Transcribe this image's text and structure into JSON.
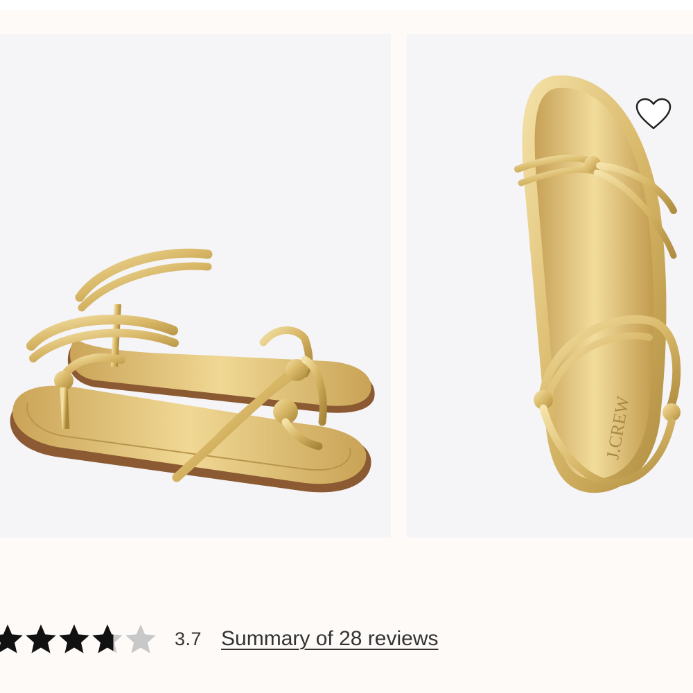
{
  "product": {
    "images": [
      {
        "name": "sandals-pair-angled-view"
      },
      {
        "name": "sandal-top-view"
      }
    ],
    "insole_brand": "J.CREW",
    "wishlist_icon": "heart-outline-icon"
  },
  "rating": {
    "value": "3.7",
    "max": 5,
    "filled_fraction": 0.74,
    "star_icon": "star-icon",
    "reviews_link": "Summary of 28 reviews"
  },
  "colors": {
    "star_filled": "#111111",
    "star_empty": "#c8c8c8",
    "text": "#333333",
    "image_background": "#f5f4f7",
    "gold": "#d9b96a"
  }
}
